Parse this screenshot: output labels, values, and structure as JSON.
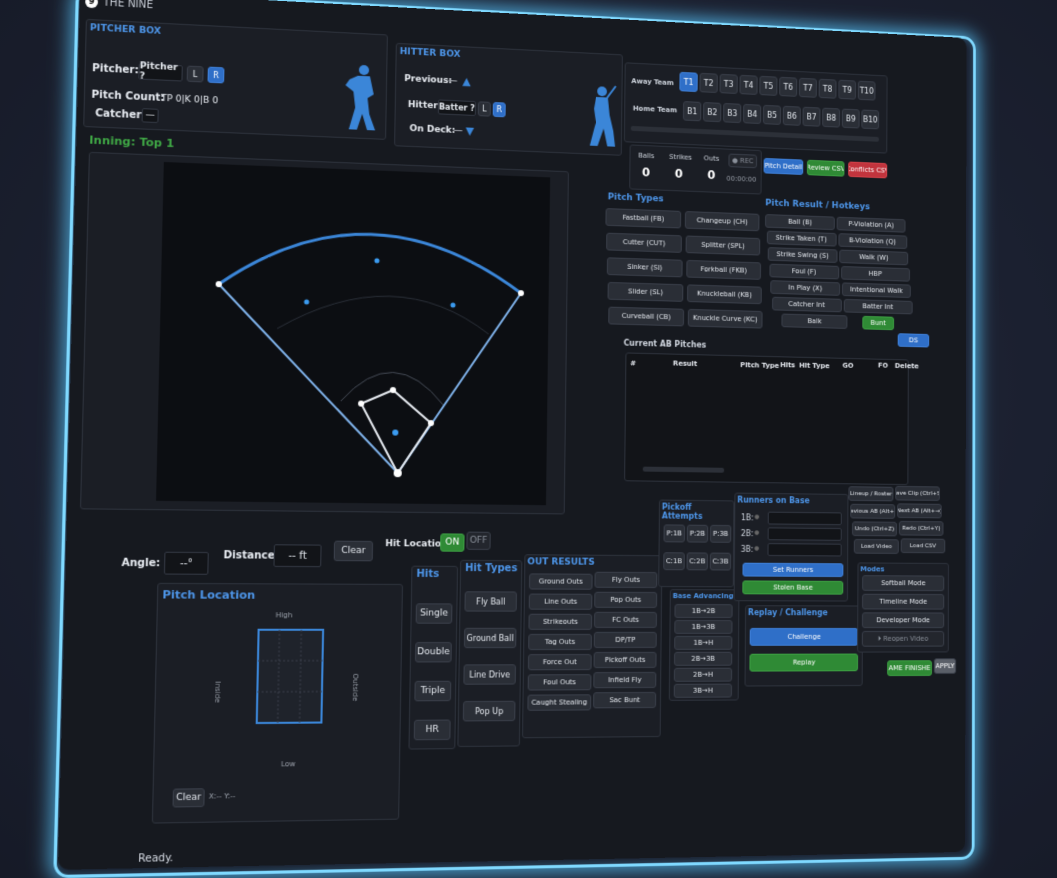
{
  "app": {
    "title": "THE NINE",
    "icon": "nine-logo-icon"
  },
  "window_controls": {
    "minimize": "–",
    "maximize": "☐",
    "close": "×"
  },
  "pitcher_box": {
    "title": "PITCHER BOX",
    "pitcher_label": "Pitcher:",
    "pitcher_value": "Pitcher ?",
    "hand_left": "L",
    "hand_right": "R",
    "count_label": "Pitch Count:",
    "count_value": "TP 0|K 0|B 0",
    "catcher_label": "Catcher:",
    "catcher_value": "—"
  },
  "hitter_box": {
    "title": "HITTER BOX",
    "previous_label": "Previous:",
    "previous_value": "—",
    "hitter_label": "Hitter:",
    "hitter_value": "Batter ?",
    "hand_left": "L",
    "hand_right": "R",
    "ondeck_label": "On Deck:",
    "ondeck_value": "—"
  },
  "teams": {
    "away_label": "Away Team",
    "home_label": "Home Team",
    "away": [
      "T1",
      "T2",
      "T3",
      "T4",
      "T5",
      "T6",
      "T7",
      "T8",
      "T9",
      "T10"
    ],
    "home": [
      "B1",
      "B2",
      "B3",
      "B4",
      "B5",
      "B6",
      "B7",
      "B8",
      "B9",
      "B10"
    ]
  },
  "count": {
    "balls_label": "Balls",
    "balls": "0",
    "strikes_label": "Strikes",
    "strikes": "0",
    "outs_label": "Outs",
    "outs": "0",
    "rec_label": "● REC",
    "timer": "00:00:00"
  },
  "top_buttons": {
    "pitch_detail": "Pitch Detail",
    "review_csv": "Review CSV",
    "conflicts_csv": "Conflicts CSV"
  },
  "inning": "Inning: Top 1",
  "field": {
    "angle_label": "Angle:",
    "angle_value": "--°",
    "distance_label": "Distance:",
    "distance_value": "-- ft",
    "clear": "Clear",
    "hit_location_label": "Hit Location",
    "on": "ON",
    "off": "OFF"
  },
  "pitch_types": {
    "title": "Pitch Types",
    "items": [
      "Fastball (FB)",
      "Changeup (CH)",
      "Cutter (CUT)",
      "Splitter (SPL)",
      "Sinker (SI)",
      "Forkball (FKB)",
      "Slider (SL)",
      "Knuckleball (KB)",
      "Curveball (CB)",
      "Knuckle Curve (KC)"
    ]
  },
  "pitch_result": {
    "title": "Pitch Result / Hotkeys",
    "items": [
      "Ball (B)",
      "P-Violation (A)",
      "Strike Taken (T)",
      "B-Violation (Q)",
      "Strike Swing (S)",
      "Walk (W)",
      "Foul (F)",
      "HBP",
      "In Play (X)",
      "Intentional Walk",
      "Catcher Int",
      "Batter Int",
      "Balk",
      "Bunt",
      "DS"
    ]
  },
  "current_ab": {
    "title": "Current AB Pitches",
    "columns": [
      "#",
      "Result",
      "Pitch Type",
      "Hits",
      "Hit Type",
      "GO",
      "FO",
      "Delete"
    ]
  },
  "pitch_location": {
    "title": "Pitch Location",
    "high": "High",
    "low": "Low",
    "inside": "Inside",
    "outside": "Outside",
    "clear": "Clear",
    "coords": "X:-- Y:--"
  },
  "hits": {
    "title": "Hits",
    "items": [
      "Single",
      "Double",
      "Triple",
      "HR"
    ]
  },
  "hit_types": {
    "title": "Hit Types",
    "items": [
      "Fly Ball",
      "Ground Ball",
      "Line Drive",
      "Pop Up"
    ]
  },
  "out_results": {
    "title": "OUT RESULTS",
    "col1": [
      "Ground Outs",
      "Line Outs",
      "Strikeouts",
      "Tag Outs",
      "Force Out",
      "Foul Outs",
      "Caught Stealing"
    ],
    "col2": [
      "Fly Outs",
      "Pop Outs",
      "FC Outs",
      "DP/TP",
      "Pickoff Outs",
      "Infield Fly",
      "Sac Bunt"
    ]
  },
  "pickoff": {
    "title": "Pickoff Attempts",
    "items": [
      "P:1B",
      "P:2B",
      "P:3B",
      "C:1B",
      "C:2B",
      "C:3B"
    ]
  },
  "base_advancing": {
    "title": "Base Advancing",
    "items": [
      "1B→2B",
      "1B→3B",
      "1B→H",
      "2B→3B",
      "2B→H",
      "3B→H"
    ]
  },
  "runners": {
    "title": "Runners on Base",
    "bases": [
      "1B:",
      "2B:",
      "3B:"
    ],
    "dot": "●",
    "set_runners": "Set Runners",
    "stolen_base": "Stolen Base"
  },
  "replay": {
    "title": "Replay / Challenge",
    "challenge": "Challenge",
    "replay": "Replay"
  },
  "tools": {
    "items": [
      "Lineup / Roster",
      "Save Clip (Ctrl+S)",
      "Previous AB (Alt+←)",
      "Next AB (Alt+→)",
      "Undo (Ctrl+Z)",
      "Redo (Ctrl+Y)",
      "Load Video",
      "Load CSV"
    ]
  },
  "modes": {
    "title": "Modes",
    "items": [
      "Softball Mode",
      "Timeline Mode",
      "Developer Mode",
      "⏵ Reopen Video"
    ]
  },
  "footer": {
    "game_finished": "GAME FINISHED",
    "apply": "APPLY",
    "status": "Ready."
  }
}
